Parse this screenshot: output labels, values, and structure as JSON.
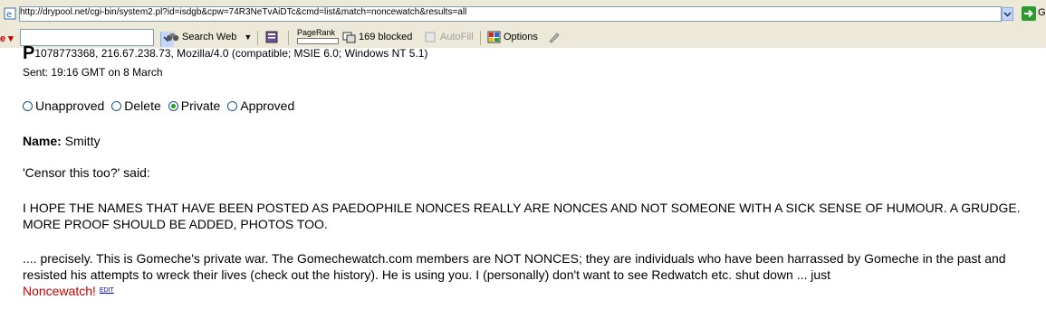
{
  "browser": {
    "url": "http://drypool.net/cgi-bin/system2.pl?id=isdgb&cpw=74R3NeTvAiDTc&cmd=list&match=noncewatch&results=all",
    "go_label": "G"
  },
  "toolbar": {
    "search_web": "Search Web",
    "pagerank": "PageRank",
    "blocked": "169 blocked",
    "autofill": "AutoFill",
    "options": "Options"
  },
  "post": {
    "p_letter": "P",
    "header_info": "1078773368, 216.67.238.73, Mozilla/4.0 (compatible; MSIE 6.0; Windows NT 5.1)",
    "sent": "Sent: 19:16 GMT on 8 March",
    "status_options": [
      {
        "label": "Unapproved",
        "checked": false
      },
      {
        "label": "Delete",
        "checked": false
      },
      {
        "label": "Private",
        "checked": true
      },
      {
        "label": "Approved",
        "checked": false
      }
    ],
    "name_label": "Name:",
    "name_value": "Smitty",
    "said": "'Censor this too?' said:",
    "quote": "I HOPE THE NAMES THAT HAVE BEEN POSTED AS PAEDOPHILE NONCES REALLY ARE NONCES AND NOT SOMEONE WITH A SICK SENSE OF HUMOUR. A GRUDGE. MORE PROOF SHOULD BE ADDED, PHOTOS TOO.",
    "reply": ".... precisely. This is Gomeche's private war. The Gomechewatch.com members are NOT NONCES; they are individuals who have been harrassed by Gomeche in the past and resisted his attempts to wreck their lives (check out the history). He is using you. I (personally) don't want to see Redwatch etc. shut down ... just",
    "reply_red": "Noncewatch!",
    "edit_label": "EDIT"
  }
}
